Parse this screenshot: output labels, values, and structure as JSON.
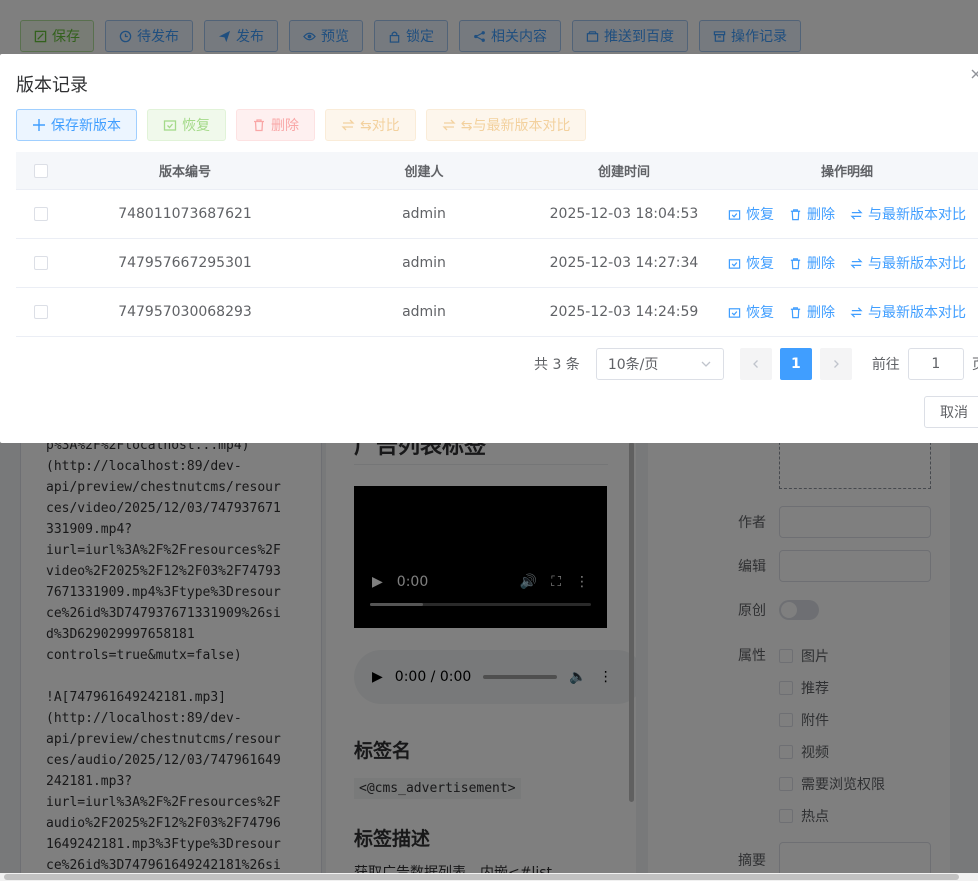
{
  "toolbar": {
    "save": "保存",
    "pending_publish": "待发布",
    "publish": "发布",
    "preview": "预览",
    "lock": "锁定",
    "related": "相关内容",
    "push_baidu": "推送到百度",
    "op_log": "操作记录"
  },
  "editor": {
    "markdown": "p%3A%2F%2Flocalhost...mp4)\n(http://localhost:89/dev-\napi/preview/chestnutcms/resour\nces/video/2025/12/03/747937671\n331909.mp4?\niurl=iurl%3A%2F%2Fresources%2F\nvideo%2F2025%2F12%2F03%2F74793\n7671331909.mp4%3Ftype%3Dresour\nce%26id%3D747937671331909%26si\nd%3D629029997658181\ncontrols=true&mutx=false)\n\n!A[747961649242181.mp3]\n(http://localhost:89/dev-\napi/preview/chestnutcms/resour\nces/audio/2025/12/03/747961649\n242181.mp3?\niurl=iurl%3A%2F%2Fresources%2F\naudio%2F2025%2F12%2F03%2F74796\n1649242181.mp3%3Ftype%3Dresour\nce%26id%3D747961649242181%26si"
  },
  "preview": {
    "title": "广告列表标签",
    "video_time": "0:00",
    "audio_time": "0:00 / 0:00",
    "tag_name_heading": "标签名",
    "tag_name_code": "<@cms_advertisement>",
    "tag_desc_heading": "标签描述",
    "tag_desc_text": "获取广告数据列表，内嵌<#list"
  },
  "form": {
    "author_label": "作者",
    "editor_label": "编辑",
    "original_label": "原创",
    "attr_label": "属性",
    "attrs": [
      "图片",
      "推荐",
      "附件",
      "视频",
      "需要浏览权限",
      "热点"
    ],
    "summary_label": "摘要"
  },
  "dialog": {
    "title": "版本记录",
    "btn_save_new": "保存新版本",
    "btn_restore": "恢复",
    "btn_delete": "删除",
    "btn_compare": "⇆对比",
    "btn_compare_latest": "⇆与最新版本对比",
    "columns": {
      "id": "版本编号",
      "creator": "创建人",
      "time": "创建时间",
      "ops": "操作明细"
    },
    "rows": [
      {
        "id": "748011073687621",
        "creator": "admin",
        "time": "2025-12-03 18:04:53"
      },
      {
        "id": "747957667295301",
        "creator": "admin",
        "time": "2025-12-03 14:27:34"
      },
      {
        "id": "747957030068293",
        "creator": "admin",
        "time": "2025-12-03 14:24:59"
      }
    ],
    "row_ops": {
      "restore": "恢复",
      "delete": "删除",
      "compare_latest": "与最新版本对比"
    },
    "pager": {
      "total": "共 3 条",
      "page_size": "10条/页",
      "current": "1",
      "goto_label": "前往",
      "goto_value": "1",
      "page_suffix": "页"
    },
    "cancel": "取消"
  }
}
